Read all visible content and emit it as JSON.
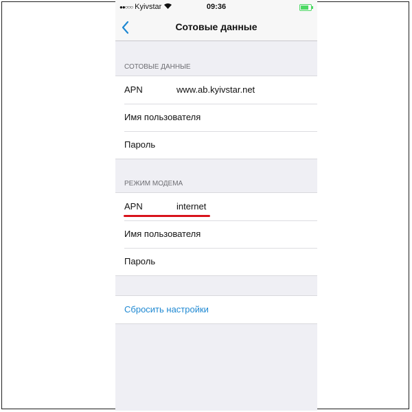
{
  "status_bar": {
    "signal": "●●○○○",
    "carrier": "Kyivstar",
    "time": "09:36"
  },
  "nav": {
    "title": "Сотовые данные"
  },
  "cellular_data": {
    "header": "СОТОВЫЕ ДАННЫЕ",
    "apn_label": "APN",
    "apn_value": "www.ab.kyivstar.net",
    "username_label": "Имя пользователя",
    "password_label": "Пароль"
  },
  "hotspot": {
    "header": "РЕЖИМ МОДЕМА",
    "apn_label": "APN",
    "apn_value": "internet",
    "username_label": "Имя пользователя",
    "password_label": "Пароль"
  },
  "reset": {
    "label": "Сбросить настройки"
  },
  "colors": {
    "accent": "#1e88d2",
    "highlight": "#d8121b",
    "battery": "#4cd964"
  },
  "icons": {
    "back": "chevron-left-icon",
    "wifi": "wifi-icon",
    "battery": "battery-icon"
  },
  "battery_level": 0.85
}
